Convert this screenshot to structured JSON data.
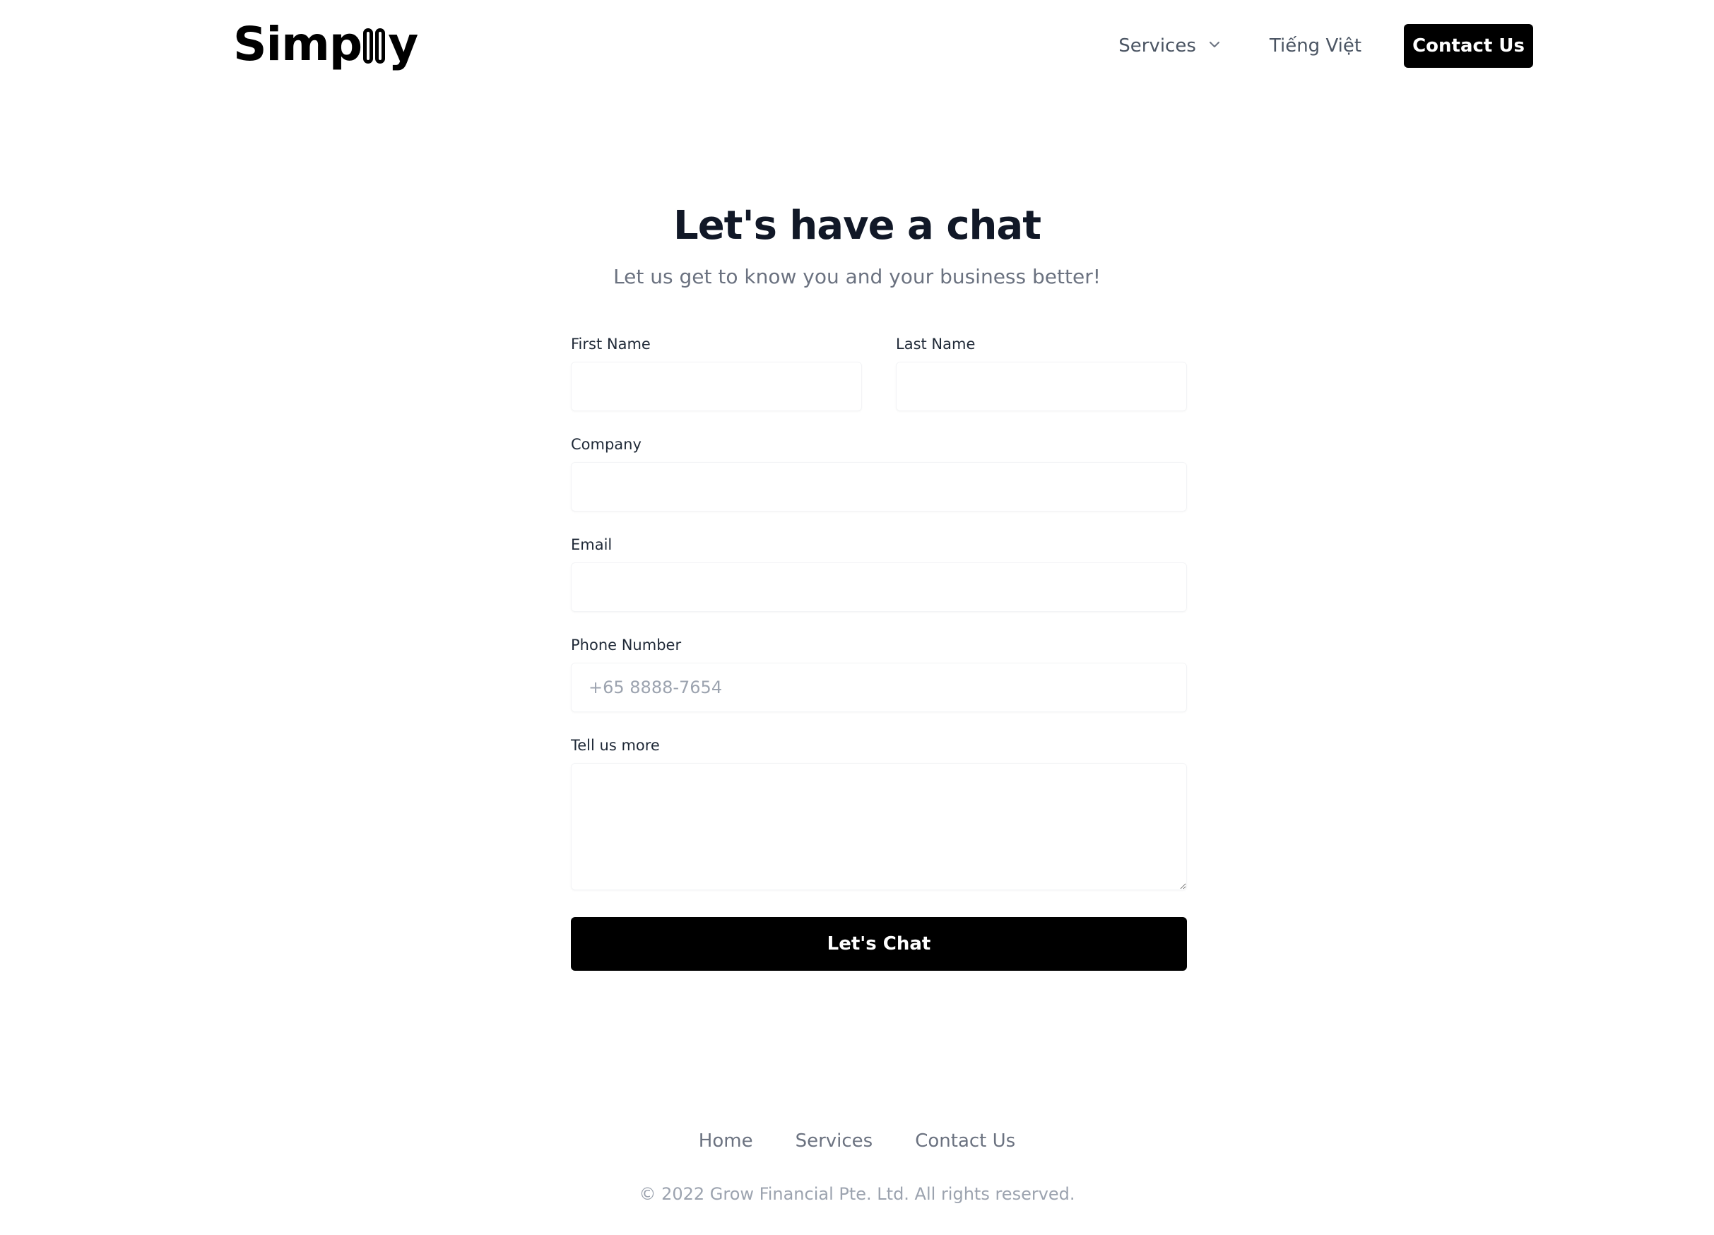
{
  "header": {
    "logo": {
      "text_before": "Simp",
      "text_after": "y"
    },
    "nav": {
      "services_label": "Services",
      "language_label": "Tiếng Việt",
      "contact_label": "Contact Us"
    }
  },
  "main": {
    "title": "Let's have a chat",
    "subtitle": "Let us get to know you and your business better!",
    "form": {
      "first_name": {
        "label": "First Name",
        "value": "",
        "placeholder": ""
      },
      "last_name": {
        "label": "Last Name",
        "value": "",
        "placeholder": ""
      },
      "company": {
        "label": "Company",
        "value": "",
        "placeholder": ""
      },
      "email": {
        "label": "Email",
        "value": "",
        "placeholder": ""
      },
      "phone": {
        "label": "Phone Number",
        "value": "",
        "placeholder": "+65 8888-7654"
      },
      "message": {
        "label": "Tell us more",
        "value": "",
        "placeholder": ""
      },
      "submit_label": "Let's Chat"
    }
  },
  "footer": {
    "links": [
      "Home",
      "Services",
      "Contact Us"
    ],
    "copyright": "© 2022 Grow Financial Pte. Ltd. All rights reserved."
  },
  "icons": {
    "logo_mark": "double-pill-logo-icon",
    "services_dropdown": "chevron-down-icon"
  },
  "colors": {
    "primary": "#000000",
    "title": "#111827",
    "muted": "#6b7280",
    "placeholder": "#9ca3af"
  }
}
